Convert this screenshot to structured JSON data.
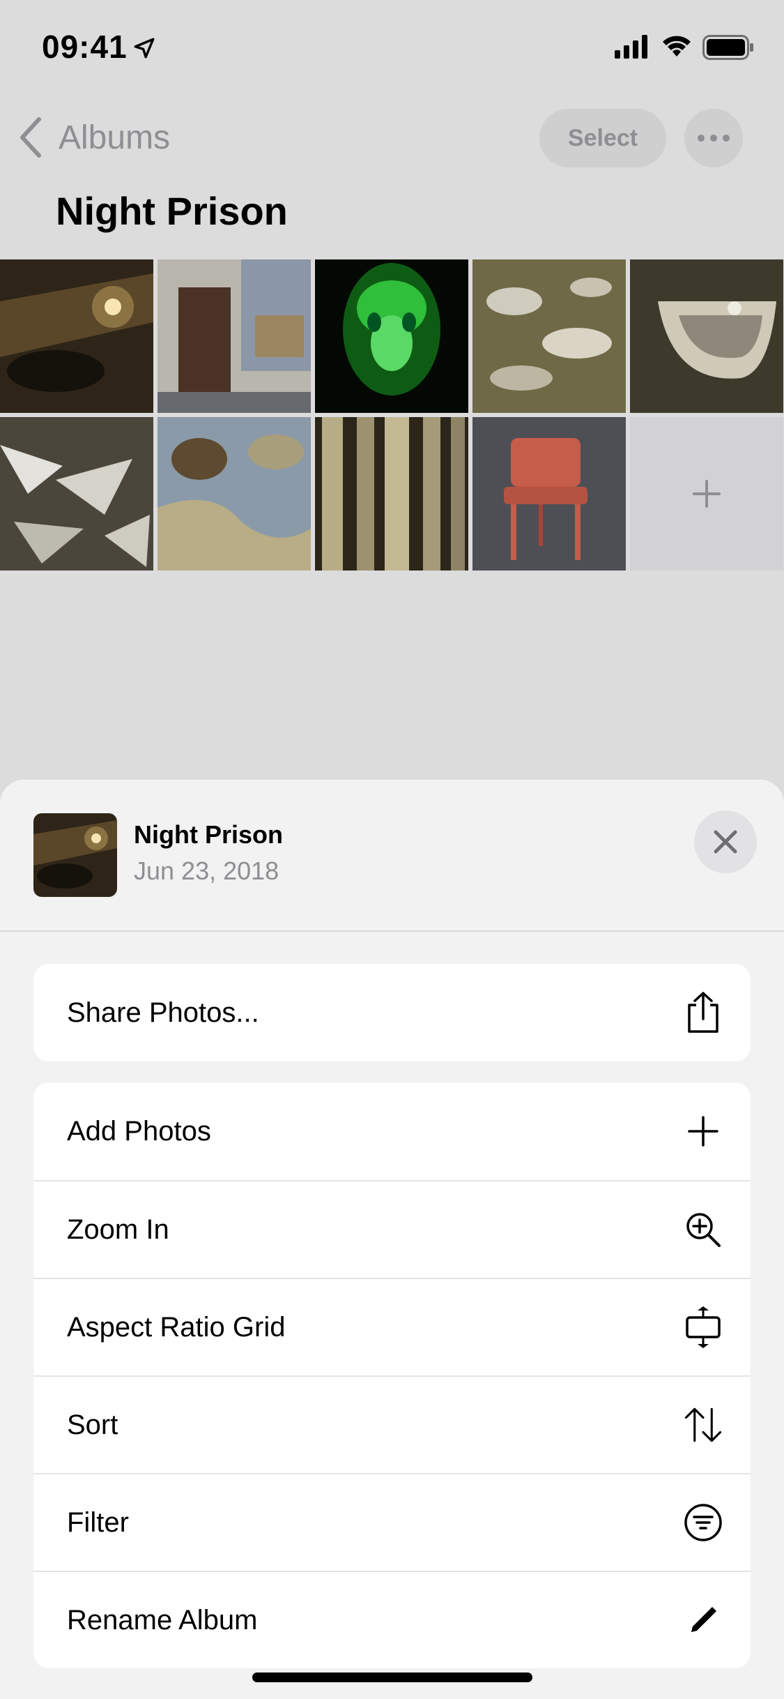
{
  "status_bar": {
    "time": "09:41"
  },
  "nav": {
    "back_label": "Albums",
    "select_label": "Select"
  },
  "album": {
    "title": "Night Prison"
  },
  "grid": {
    "photos": [
      {
        "name": "photo-1"
      },
      {
        "name": "photo-2"
      },
      {
        "name": "photo-3"
      },
      {
        "name": "photo-4"
      },
      {
        "name": "photo-5"
      },
      {
        "name": "photo-6"
      },
      {
        "name": "photo-7"
      },
      {
        "name": "photo-8"
      },
      {
        "name": "photo-9"
      }
    ],
    "add_icon": "plus-icon"
  },
  "sheet": {
    "title": "Night Prison",
    "date": "Jun 23, 2018",
    "close_icon": "close-icon",
    "share": {
      "label": "Share Photos...",
      "icon": "share-icon"
    },
    "actions": [
      {
        "label": "Add Photos",
        "icon": "plus-icon"
      },
      {
        "label": "Zoom In",
        "icon": "zoom-in-icon"
      },
      {
        "label": "Aspect Ratio Grid",
        "icon": "aspect-ratio-icon"
      },
      {
        "label": "Sort",
        "icon": "sort-icon"
      },
      {
        "label": "Filter",
        "icon": "filter-icon"
      },
      {
        "label": "Rename Album",
        "icon": "pencil-icon"
      }
    ]
  },
  "colors": {
    "background": "#dcdcdc",
    "sheet": "#f2f2f2",
    "secondary_text": "#8e8e93"
  }
}
